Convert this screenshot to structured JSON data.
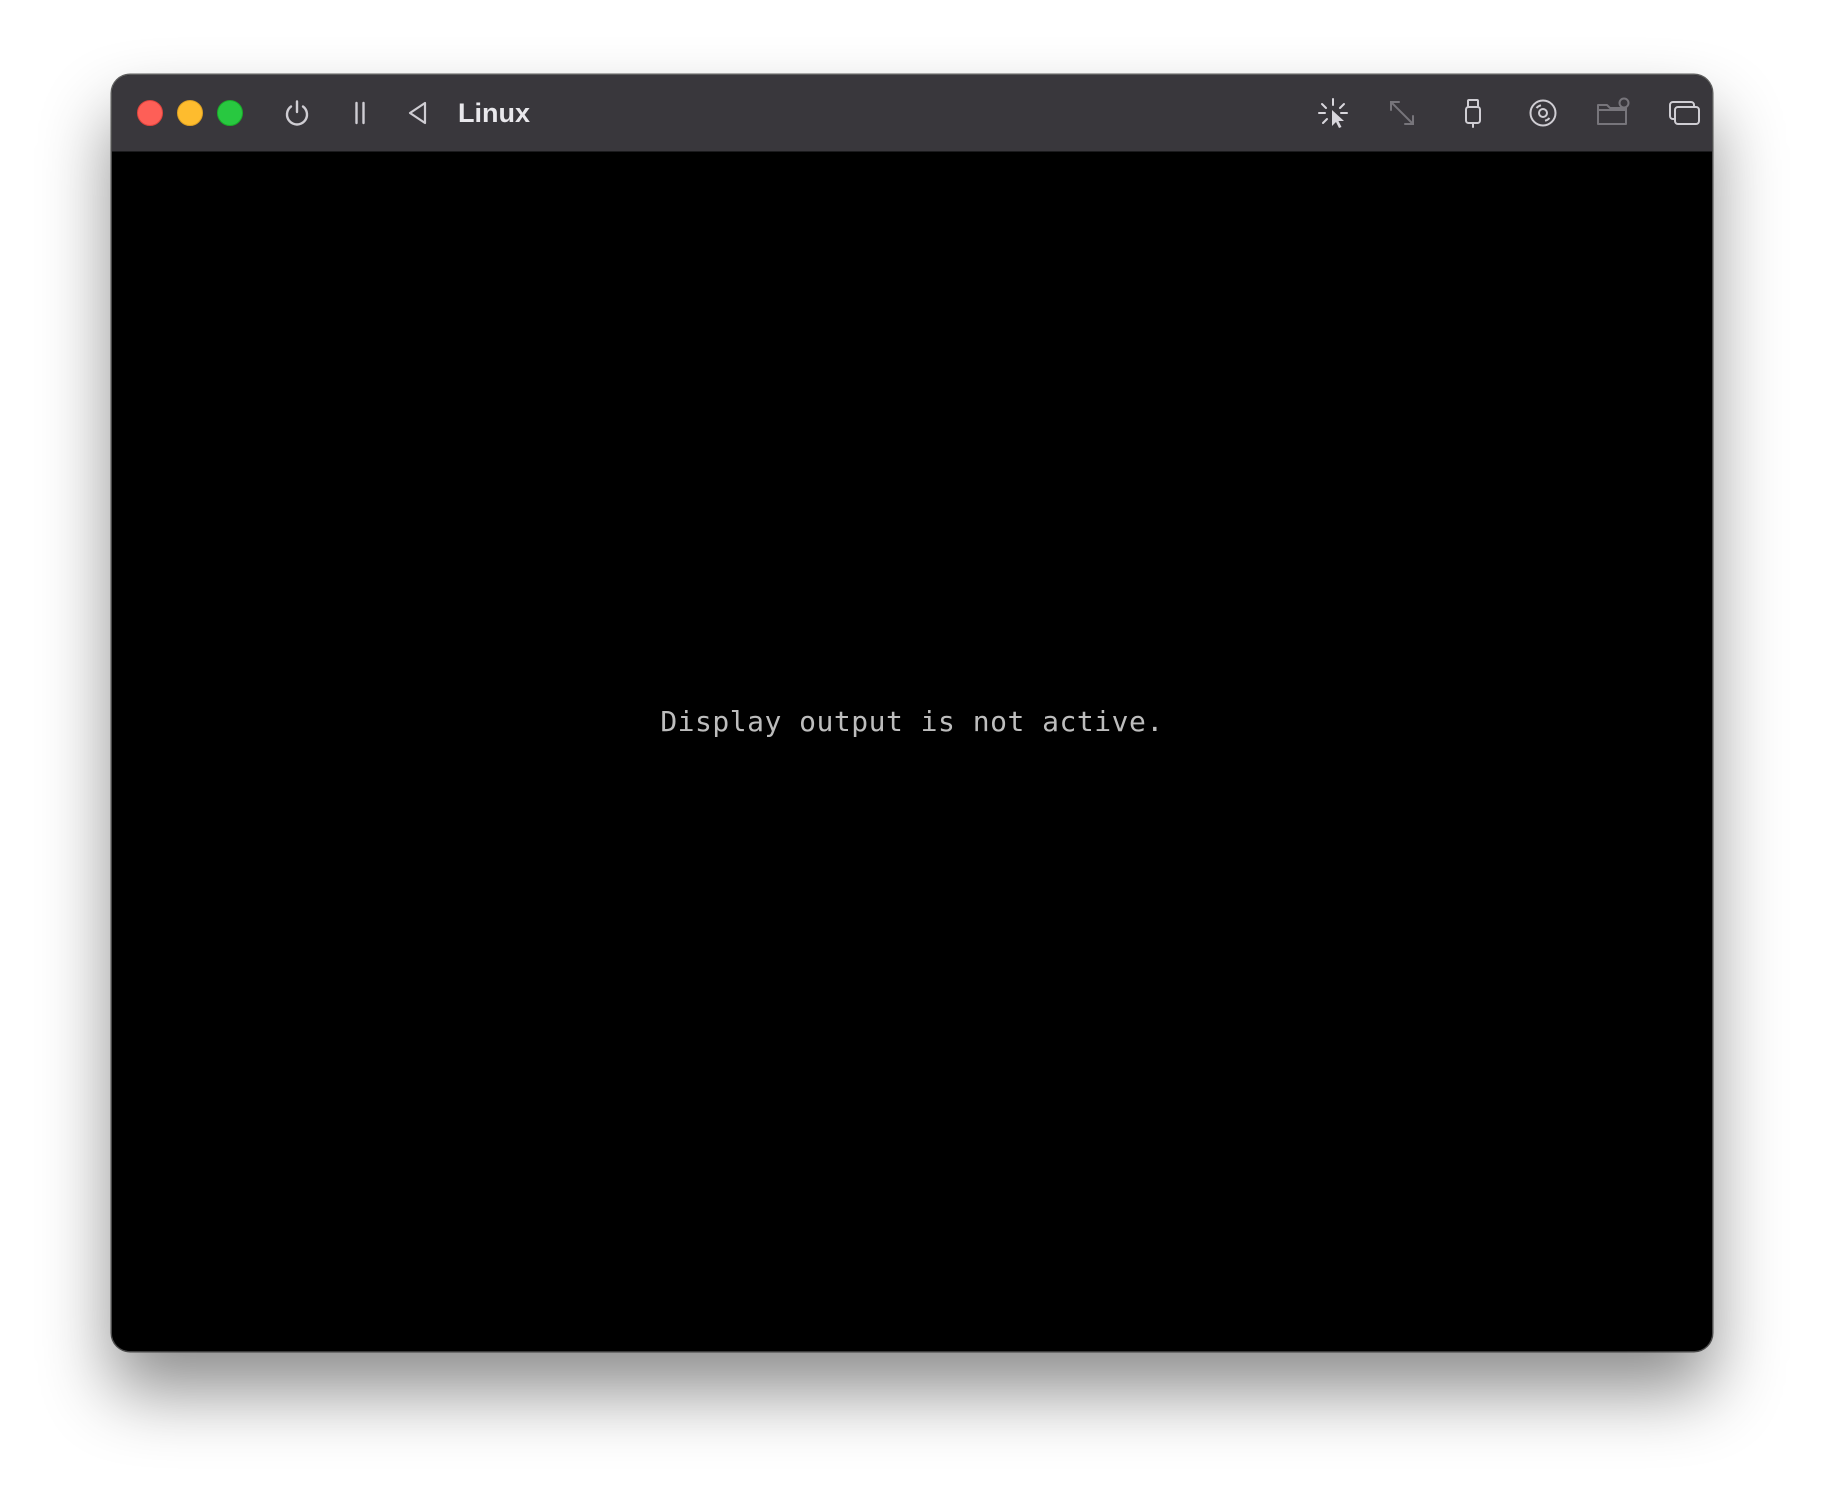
{
  "window": {
    "title": "Linux"
  },
  "toolbar": {
    "left_icons": [
      "power-icon",
      "pause-icon",
      "back-triangle-icon"
    ],
    "right_icons": [
      "capture-input-icon",
      "resize-icon",
      "usb-device-icon",
      "cd-drive-icon",
      "shared-folder-icon",
      "windows-icon"
    ]
  },
  "display": {
    "message": "Display output is not active."
  },
  "colors": {
    "titlebar": "#39373c",
    "display_background": "#000000",
    "message_text": "#bdbdbd",
    "traffic_close": "#fe5f57",
    "traffic_minimize": "#febc2e",
    "traffic_zoom": "#28c840"
  }
}
